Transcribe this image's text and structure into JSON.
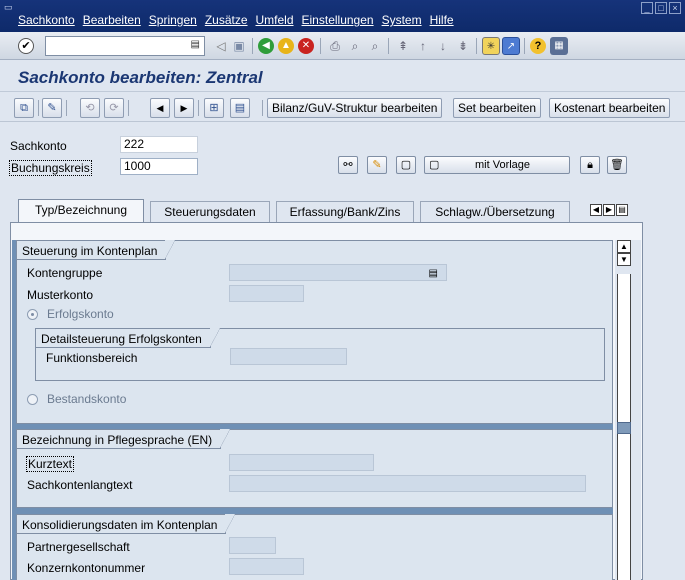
{
  "menu": [
    "Sachkonto",
    "Bearbeiten",
    "Springen",
    "Zusätze",
    "Umfeld",
    "Einstellungen",
    "System",
    "Hilfe"
  ],
  "page_title": "Sachkonto bearbeiten: Zentral",
  "app_toolbar": {
    "bilanz_label": "Bilanz/GuV-Struktur bearbeiten",
    "set_label": "Set bearbeiten",
    "kostenart_label": "Kostenart bearbeiten"
  },
  "header": {
    "sachkonto_label": "Sachkonto",
    "sachkonto_value": "222",
    "buchungskreis_label": "Buchungskreis",
    "buchungskreis_value": "1000",
    "mit_vorlage_label": "mit Vorlage"
  },
  "tabs": [
    "Typ/Bezeichnung",
    "Steuerungsdaten",
    "Erfassung/Bank/Zins",
    "Schlagw./Übersetzung"
  ],
  "groups": {
    "steuerung": {
      "title": "Steuerung im Kontenplan",
      "kontengruppe": "Kontengruppe",
      "musterkonto": "Musterkonto",
      "erfolgskonto": "Erfolgskonto",
      "detail_title": "Detailsteuerung Erfolgskonten",
      "funktionsbereich": "Funktionsbereich",
      "bestandskonto": "Bestandskonto"
    },
    "bezeichnung": {
      "title": "Bezeichnung in Pflegesprache (EN)",
      "kurztext": "Kurztext",
      "langtext": "Sachkontenlangtext"
    },
    "konsolidierung": {
      "title": "Konsolidierungsdaten im Kontenplan",
      "partner": "Partnergesellschaft",
      "konzernkonto": "Konzernkontonummer"
    }
  },
  "icons": {
    "enter": "check-circle-icon",
    "save": "save-icon",
    "back": "green-arrow-left-icon",
    "exit": "yellow-arrow-up-icon",
    "cancel": "red-x-icon"
  }
}
